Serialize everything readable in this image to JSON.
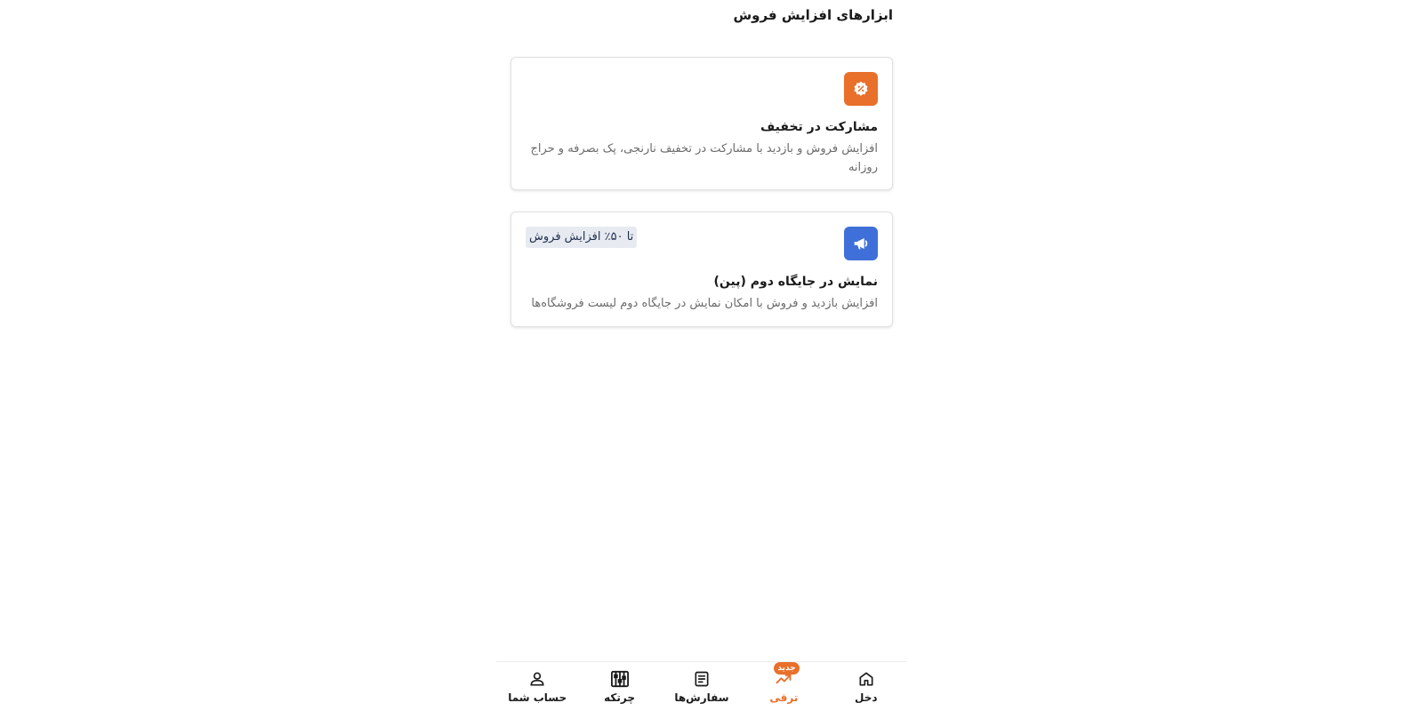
{
  "page": {
    "title": "ابزارهای افزایش فروش"
  },
  "cards": [
    {
      "title": "مشارکت در تخفیف",
      "description": "افزایش فروش و بازدید با مشارکت در تخفیف نارنجی، پک بصرفه و حراج روزانه",
      "icon": "percent-badge-icon",
      "icon_color": "#E8702A"
    },
    {
      "title": "نمایش در جایگاه دوم (پین)",
      "description": "افزایش بازدید و فروش با امکان نمایش در جایگاه دوم لیست فروشگاه‌ها",
      "icon": "megaphone-icon",
      "icon_color": "#3F6FD8",
      "badge": "تا ۵۰٪ افزایش فروش"
    }
  ],
  "bottom_nav": {
    "items": [
      {
        "label": "دخل",
        "icon": "home-icon"
      },
      {
        "label": "ترقی",
        "icon": "trending-up-icon",
        "active": true,
        "new_badge": "جدید"
      },
      {
        "label": "سفارش‌ها",
        "icon": "orders-list-icon"
      },
      {
        "label": "چرتکه",
        "icon": "abacus-icon"
      },
      {
        "label": "حساب شما",
        "icon": "user-icon"
      }
    ],
    "active_color": "#E8702A"
  }
}
